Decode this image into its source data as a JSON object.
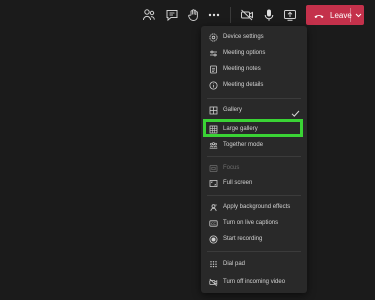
{
  "colors": {
    "background": "#1b1b1b",
    "menu_bg": "#292929",
    "leave_red": "#c4314b",
    "highlight_green": "#3ad335",
    "text": "#d2d2d2",
    "text_disabled": "#6e6e6e"
  },
  "toolbar": {
    "icons": [
      "people-icon",
      "chat-icon",
      "raise-hand-icon",
      "more-actions-icon",
      "camera-off-icon",
      "microphone-icon",
      "share-tray-icon"
    ],
    "leave_label": "Leave"
  },
  "menu": {
    "items": [
      {
        "label": "Device settings",
        "icon": "gear-icon"
      },
      {
        "label": "Meeting options",
        "icon": "options-icon"
      },
      {
        "label": "Meeting notes",
        "icon": "notes-icon"
      },
      {
        "label": "Meeting details",
        "icon": "info-icon"
      },
      {
        "label": "Gallery",
        "icon": "gallery-icon",
        "checked": true
      },
      {
        "label": "Large gallery",
        "icon": "large-gallery-icon",
        "highlighted": true
      },
      {
        "label": "Together mode",
        "icon": "together-mode-icon"
      },
      {
        "label": "Focus",
        "icon": "focus-icon",
        "disabled": true
      },
      {
        "label": "Full screen",
        "icon": "full-screen-icon"
      },
      {
        "label": "Apply background effects",
        "icon": "background-effects-icon"
      },
      {
        "label": "Turn on live captions",
        "icon": "captions-icon"
      },
      {
        "label": "Start recording",
        "icon": "record-icon"
      },
      {
        "label": "Dial pad",
        "icon": "dial-pad-icon"
      },
      {
        "label": "Turn off incoming video",
        "icon": "video-off-icon"
      }
    ]
  }
}
